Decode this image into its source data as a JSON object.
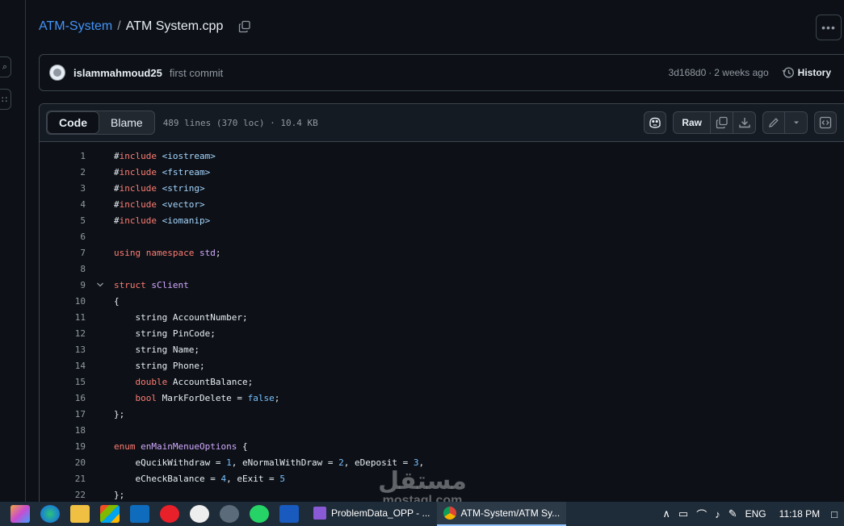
{
  "breadcrumb": {
    "repo": "ATM-System",
    "separator": "/",
    "file": "ATM System.cpp"
  },
  "commit": {
    "author": "islammahmoud25",
    "message": "first commit",
    "sha": "3d168d0",
    "dot": "·",
    "age": "2 weeks ago",
    "history_label": "History"
  },
  "file_header": {
    "tabs": [
      {
        "label": "Code",
        "active": true
      },
      {
        "label": "Blame",
        "active": false
      }
    ],
    "info": "489 lines (370 loc) · 10.4 KB",
    "raw_label": "Raw"
  },
  "code_lines": [
    {
      "n": "1",
      "fold": false,
      "text": "#include <iostream>"
    },
    {
      "n": "2",
      "fold": false,
      "text": "#include <fstream>"
    },
    {
      "n": "3",
      "fold": false,
      "text": "#include <string>"
    },
    {
      "n": "4",
      "fold": false,
      "text": "#include <vector>"
    },
    {
      "n": "5",
      "fold": false,
      "text": "#include <iomanip>"
    },
    {
      "n": "6",
      "fold": false,
      "text": ""
    },
    {
      "n": "7",
      "fold": false,
      "text": "using namespace std;"
    },
    {
      "n": "8",
      "fold": false,
      "text": ""
    },
    {
      "n": "9",
      "fold": true,
      "text": "struct sClient"
    },
    {
      "n": "10",
      "fold": false,
      "text": "{"
    },
    {
      "n": "11",
      "fold": false,
      "text": "    string AccountNumber;"
    },
    {
      "n": "12",
      "fold": false,
      "text": "    string PinCode;"
    },
    {
      "n": "13",
      "fold": false,
      "text": "    string Name;"
    },
    {
      "n": "14",
      "fold": false,
      "text": "    string Phone;"
    },
    {
      "n": "15",
      "fold": false,
      "text": "    double AccountBalance;"
    },
    {
      "n": "16",
      "fold": false,
      "text": "    bool MarkForDelete = false;"
    },
    {
      "n": "17",
      "fold": false,
      "text": "};"
    },
    {
      "n": "18",
      "fold": false,
      "text": ""
    },
    {
      "n": "19",
      "fold": false,
      "text": "enum enMainMenueOptions {"
    },
    {
      "n": "20",
      "fold": false,
      "text": "    eQucikWithdraw = 1, eNormalWithDraw = 2, eDeposit = 3,"
    },
    {
      "n": "21",
      "fold": false,
      "text": "    eCheckBalance = 4, eExit = 5"
    },
    {
      "n": "22",
      "fold": false,
      "text": "};"
    }
  ],
  "watermark": {
    "arabic": "مستقل",
    "latin": "mostaql.com"
  },
  "taskbar": {
    "apps": [
      {
        "label": "ProblemData_OPP - ...",
        "icon": "visual-studio-icon",
        "active": false
      },
      {
        "label": "ATM-System/ATM Sy...",
        "icon": "chrome-icon",
        "active": true
      }
    ],
    "language": "ENG",
    "time": "11:18 PM"
  },
  "colors": {
    "background": "#0d1117",
    "link": "#4493f8",
    "keyword": "#ff7b72",
    "string": "#a5d6ff",
    "type": "#ffa657",
    "entity": "#d2a8ff",
    "constant": "#79c0ff"
  }
}
